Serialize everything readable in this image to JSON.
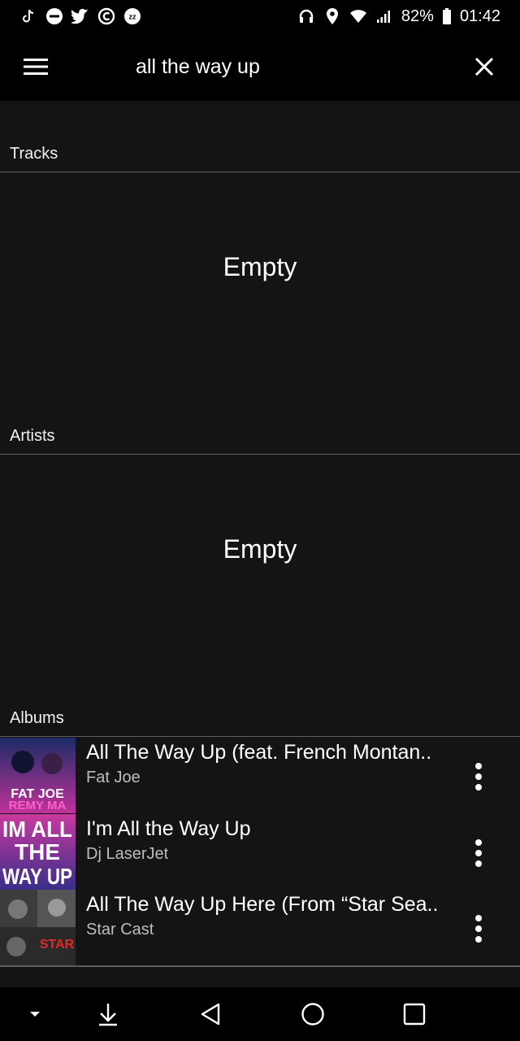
{
  "status_bar": {
    "left_icons": [
      "tiktok-icon",
      "minus-circle-icon",
      "twitter-icon",
      "chat-c-icon",
      "zz-icon"
    ],
    "right_icons": [
      "headphones-icon",
      "location-pin-icon",
      "wifi-icon",
      "signal-icon",
      "battery-icon"
    ],
    "battery_percent": "82%",
    "time": "01:42"
  },
  "top_bar": {
    "menu_icon": "hamburger-menu-icon",
    "search_value": "all the way up",
    "close_icon": "close-icon"
  },
  "sections": {
    "tracks": {
      "title": "Tracks",
      "empty_text": "Empty"
    },
    "artists": {
      "title": "Artists",
      "empty_text": "Empty"
    },
    "albums": {
      "title": "Albums",
      "items": [
        {
          "title": "All The Way Up (feat. French Montan..",
          "artist": "Fat Joe",
          "art_text": [
            "FAT JOE",
            "REMY MA"
          ],
          "art_colors": [
            "#1b2c66",
            "#c0329b"
          ]
        },
        {
          "title": "I'm All the Way Up",
          "artist": "Dj LaserJet",
          "art_text": [
            "IM ALL",
            "THE",
            "WAY UP"
          ],
          "art_colors": [
            "#c83a9e",
            "#3a2e8a"
          ]
        },
        {
          "title": "All The Way Up Here (From “Star Sea..",
          "artist": "Star Cast",
          "art_text": [
            "STAR"
          ],
          "art_colors": [
            "#2a2a2a",
            "#cc2222"
          ]
        }
      ]
    }
  },
  "nav_bar": {
    "icons": [
      "chevron-down-icon",
      "download-arrow-icon",
      "back-triangle-icon",
      "home-circle-icon",
      "recents-square-icon"
    ]
  },
  "colors": {
    "background": "#141414",
    "bars": "#000000",
    "divider": "#5e5e5e",
    "secondary_text": "#bdbdbd"
  }
}
